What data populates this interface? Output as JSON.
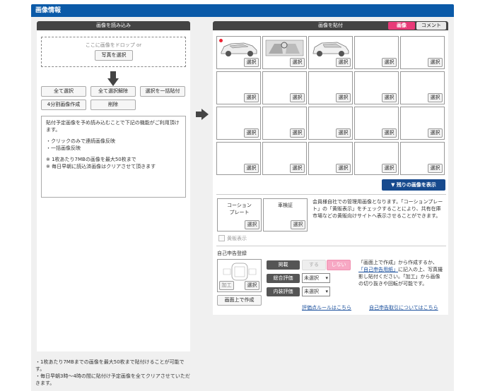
{
  "header": {
    "title": "画像情報"
  },
  "left": {
    "title": "画像を読み込み",
    "drop_hint": "ここに画像をドロップ or",
    "select_photo": "写真を選択",
    "buttons": {
      "select_all": "全て選択",
      "deselect_all": "全て選択解除",
      "bulk_paste": "選択を一括貼付",
      "split4": "4分割画像作成",
      "delete": "削除"
    },
    "info": {
      "line1": "貼付予定画像を予め読み込むことで下記の機能がご利用頂けます。",
      "item1": "・クリックのみで連続画像反映",
      "item2": "・一括画像反映",
      "note1": "※ 1枚あたり7MBの画像を最大50枚まで",
      "note2": "※ 毎日早朝に読込済画像はクリアさせて頂きます"
    },
    "bottom_note1": "・1枚あたり7MBまでの画像を最大50枚まで貼付けることが可能です。",
    "bottom_note2": "・毎日早朝3時～4時の間に貼付け予定画像を全てクリアさせていただきます。"
  },
  "right": {
    "title": "画像を貼付",
    "tabs": {
      "image": "画像",
      "comment": "コメント"
    },
    "select_label": "選択",
    "show_rest": "▼ 残りの画像を表示",
    "corporation_plate": "コーションプレート",
    "inspection_cert": "車検証",
    "corp_desc": "会員様自社での管理用画像となります。「コーションプレート」の「黄販表示」をチェックすることにより、共有在庫市場などの黄販向けサイトへ表示させることができます。",
    "yellow_display": "黄販表示",
    "self_report_title": "自己申告登録",
    "edit_label": "加工",
    "create_on_screen": "画面上で作成",
    "listing_label": "掲載",
    "listing_yes": "する",
    "listing_no": "しない",
    "overall_label": "総合評価",
    "interior_label": "内装評価",
    "unselected": "未選択",
    "self_desc_a": "「画面上で作成」から作成するか、",
    "self_desc_link": "「自己申告用紙」",
    "self_desc_b": "に記入の上、写真撮影し貼付ください。「加工」から画像の切り抜きや回転が可能です。",
    "rating_rules_link": "評価点ルールはこちら",
    "self_report_link": "自己申告取引についてはこちら"
  },
  "colors": {
    "header": "#0b5aa8",
    "active_tab": "#e83a78",
    "show_rest_btn": "#174a8e",
    "no_btn": "#f7a8c4"
  }
}
